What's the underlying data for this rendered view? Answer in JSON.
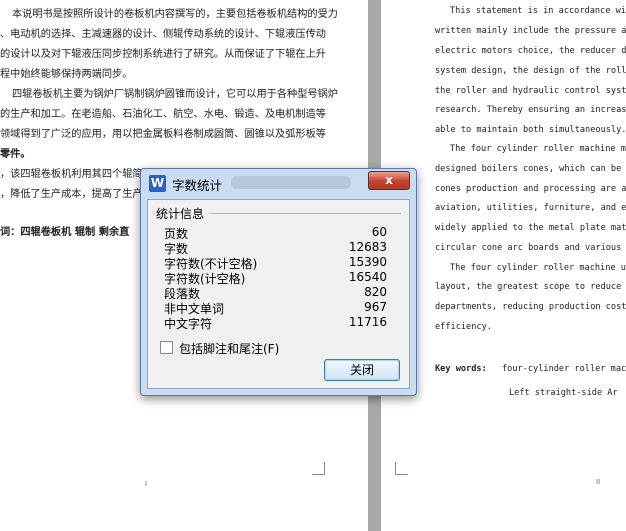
{
  "left_page": {
    "lines": [
      "本说明书是按照所设计的卷板机内容撰写的，主要包括卷板机结构的受力",
      "、电动机的选择、主减速器的设计、侧辊传动系统的设计、下辊液压传动",
      "的设计以及对下辊液压同步控制系统进行了研究。从而保证了下辊在上升",
      "程中始终能够保持两端同步。",
      "四辊卷板机主要为锅炉厂锅制锅炉圆锥而设计，它可以用于各种型号锅炉",
      "的生产和加工。在老造船、石油化工、航空、水电、锻造、及电机制造等",
      "领域得到了广泛的应用，用以把金属板料卷制成圆筒、圆锥以及弧形板等",
      "零件。",
      "，该四辊卷板机利用其四个辊简的",
      "，降低了生产成本，提高了生产效",
      "词：四辊卷板机    辊制    剩余直"
    ],
    "page_number": "I"
  },
  "right_page": {
    "lines": [
      "This statement is in accordance with",
      "written mainly include the pressure anal",
      "electric motors choice, the reducer design",
      "system design, the design of the roller h",
      "the roller and hydraulic control system",
      "research. Thereby ensuring an increase in",
      "able to maintain both simultaneously.",
      "The four cylinder roller machine main",
      "designed boilers cones, which can be used",
      "cones production and processing are also",
      "aviation, utilities, furniture, and elect",
      "widely applied to the metal plate materi",
      "circular cone arc boards and various pa",
      "The four cylinder roller machine use i",
      "layout, the greatest scope to reduce the",
      "departments, reducing production costs,",
      "efficiency."
    ],
    "keywords_label": "Key words:",
    "keywords_text": "four-cylinder roller machi",
    "keywords_line2": "Left straight-side    Ar",
    "page_number": "II"
  },
  "dialog": {
    "title": "字数统计",
    "app_icon": "W",
    "close_symbol": "x",
    "group_title": "统计信息",
    "stats": [
      {
        "label": "页数",
        "value": "60"
      },
      {
        "label": "字数",
        "value": "12683"
      },
      {
        "label": "字符数(不计空格)",
        "value": "15390"
      },
      {
        "label": "字符数(计空格)",
        "value": "16540"
      },
      {
        "label": "段落数",
        "value": "820"
      },
      {
        "label": "非中文单词",
        "value": "967"
      },
      {
        "label": "中文字符",
        "value": "11716"
      }
    ],
    "checkbox_label": "包括脚注和尾注(F)",
    "checkbox_checked": false,
    "close_button": "关闭"
  }
}
